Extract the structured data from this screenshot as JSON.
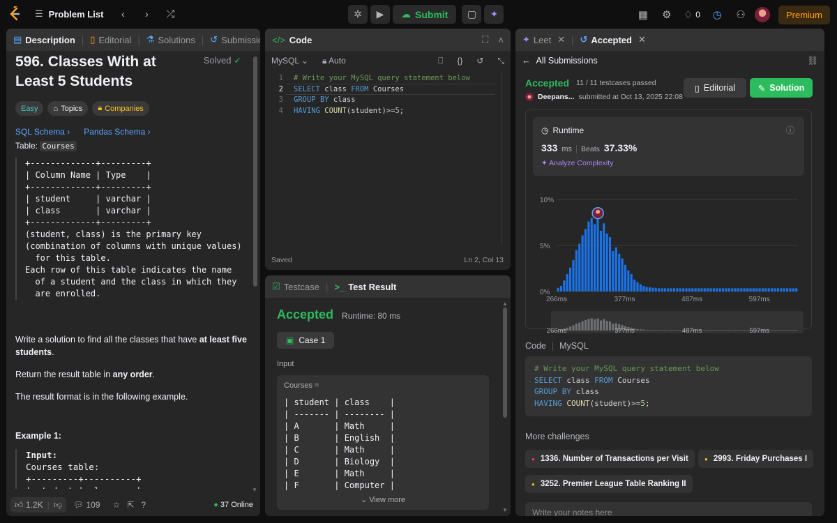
{
  "topbar": {
    "problem_list": "Problem List",
    "submit": "Submit",
    "streak": "0",
    "premium": "Premium"
  },
  "left": {
    "tabs": [
      "Description",
      "Editorial",
      "Solutions",
      "Submissions"
    ],
    "title": "596. Classes With at Least 5 Students",
    "solved": "Solved",
    "tags": [
      "Easy",
      "Topics",
      "Companies"
    ],
    "schema_links": [
      "SQL Schema",
      "Pandas Schema"
    ],
    "table_label": "Table:",
    "table_name": "Courses",
    "schema_text": "+-------------+---------+\n| Column Name | Type    |\n+-------------+---------+\n| student     | varchar |\n| class       | varchar |\n+-------------+---------+\n(student, class) is the primary key\n(combination of columns with unique values)\n  for this table.\nEach row of this table indicates the name\n  of a student and the class in which they\n  are enrolled.",
    "p1_a": "Write a solution to find all the classes that have ",
    "p1_b": "at least five students",
    "p1_c": ".",
    "p2_a": "Return the result table in ",
    "p2_b": "any order",
    "p2_c": ".",
    "p3": "The result format is in the following example.",
    "example_title": "Example 1:",
    "example_input_label": "Input:",
    "example_text": "Courses table:\n+---------+----------+\n| student | class    |",
    "footer": {
      "likes": "1.2K",
      "comments": "109",
      "online": "37 Online"
    }
  },
  "code": {
    "title": "Code",
    "language": "MySQL",
    "auto": "Auto",
    "lines": [
      "# Write your MySQL query statement below",
      "SELECT class FROM Courses",
      "GROUP BY class",
      "HAVING COUNT(student)>=5;"
    ],
    "line_numbers": [
      "1",
      "2",
      "3",
      "4"
    ],
    "status": "Saved",
    "cursor": "Ln 2, Col 13"
  },
  "test": {
    "tabs": [
      "Testcase",
      "Test Result"
    ],
    "result": "Accepted",
    "runtime": "Runtime: 80 ms",
    "case": "Case 1",
    "input_label": "Input",
    "var": "Courses =",
    "table_rows": [
      "| student | class    |",
      "| ------- | -------- |",
      "| A       | Math     |",
      "| B       | English  |",
      "| C       | Math     |",
      "| D       | Biology  |",
      "| E       | Math     |",
      "| F       | Computer |"
    ],
    "view_more": "View more"
  },
  "right": {
    "tabs": [
      "Leet",
      "Accepted"
    ],
    "all_submissions": "All Submissions",
    "status": "Accepted",
    "testcases": "11 / 11 testcases passed",
    "user": "Deepans...",
    "submitted": "submitted at Oct 13, 2025 22:08",
    "editorial": "Editorial",
    "solution": "Solution",
    "runtime_label": "Runtime",
    "runtime_value": "333",
    "runtime_unit": "ms",
    "beats_label": "Beats",
    "beats_value": "37.33%",
    "analyze": "Analyze Complexity",
    "code_label": "Code",
    "code_lang": "MySQL",
    "more_challenges": "More challenges",
    "challenges": [
      {
        "title": "1336. Number of Transactions per Visit",
        "color": "#ff375f"
      },
      {
        "title": "2993. Friday Purchases I",
        "color": "#ffc01e"
      },
      {
        "title": "3252. Premier League Table Ranking II",
        "color": "#ffc01e"
      }
    ],
    "notes_placeholder": "Write your notes here"
  },
  "chart_data": {
    "type": "bar",
    "ylabel_ticks": [
      "10%",
      "5%",
      "0%"
    ],
    "xlabel_ticks": [
      "266ms",
      "377ms",
      "487ms",
      "597ms"
    ],
    "ylim": [
      0,
      10
    ],
    "x_range_ms": [
      266,
      660
    ],
    "highlight_ms": 333,
    "values": [
      0.4,
      0.6,
      1.2,
      1.9,
      2.6,
      3.4,
      4.5,
      5.2,
      6.1,
      6.8,
      7.6,
      8.0,
      7.3,
      7.9,
      6.6,
      7.4,
      6.3,
      5.9,
      4.4,
      4.8,
      4.1,
      3.6,
      2.9,
      2.3,
      1.9,
      1.3,
      1.0,
      0.8,
      0.6,
      0.5,
      0.45,
      0.4,
      0.4,
      0.35,
      0.35,
      0.35,
      0.35,
      0.35,
      0.35,
      0.35,
      0.35,
      0.35,
      0.35,
      0.35,
      0.35,
      0.35,
      0.35,
      0.35,
      0.35,
      0.35,
      0.35,
      0.35,
      0.35,
      0.35,
      0.35,
      0.35,
      0.35,
      0.35,
      0.35,
      0.35,
      0.35,
      0.35,
      0.35,
      0.35,
      0.35,
      0.35,
      0.35,
      0.35,
      0.35,
      0.35,
      0.35,
      0.35,
      0.35,
      0.35,
      0.35,
      0.35,
      0.35,
      0.35,
      0.35
    ],
    "bar_color": "#1a73e8",
    "grid": true
  }
}
